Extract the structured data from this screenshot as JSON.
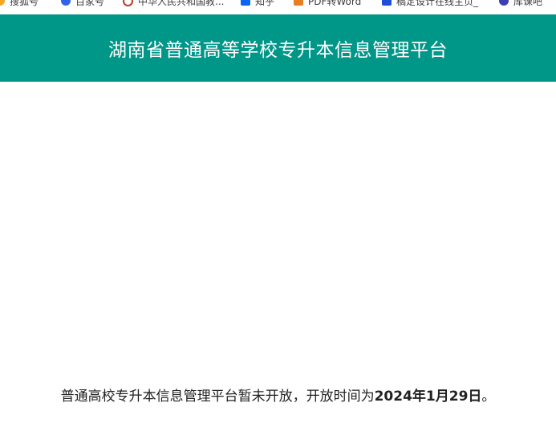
{
  "bookmarks": [
    {
      "label": "搜狐号",
      "icon": "sohu-icon",
      "color": "#f5a623"
    },
    {
      "label": "百家号",
      "icon": "baijiahao-icon",
      "color": "#3064e8"
    },
    {
      "label": "中华人民共和国教...",
      "icon": "moe-icon",
      "color": "#c0392b"
    },
    {
      "label": "知乎",
      "icon": "zhihu-icon",
      "color": "#0a66f0"
    },
    {
      "label": "PDF转Word",
      "icon": "pdf-word-icon",
      "color": "#e67e22"
    },
    {
      "label": "稿定设计在线主页_",
      "icon": "gaoding-icon",
      "color": "#1e4fd8"
    },
    {
      "label": "库课吧",
      "icon": "kuke-icon",
      "color": "#3b3fb6"
    }
  ],
  "header": {
    "title": "湖南省普通高等学校专升本信息管理平台",
    "background": "#009688"
  },
  "notice": {
    "prefix": "普通高校专升本信息管理平台暂未开放，开放时间为",
    "date": "2024年1月29日",
    "suffix": "。"
  }
}
